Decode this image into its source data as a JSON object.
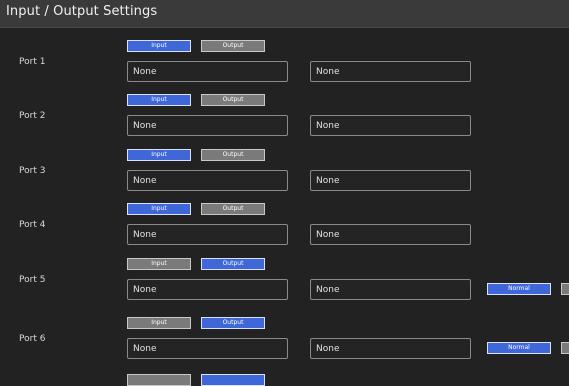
{
  "window": {
    "title": "Input / Output Settings"
  },
  "button_labels": {
    "input": "Input",
    "output": "Output",
    "normal": "Normal"
  },
  "ports": [
    {
      "label": "Port 1",
      "mode": "input",
      "field1": "None",
      "field2": "None"
    },
    {
      "label": "Port 2",
      "mode": "input",
      "field1": "None",
      "field2": "None"
    },
    {
      "label": "Port 3",
      "mode": "input",
      "field1": "None",
      "field2": "None"
    },
    {
      "label": "Port 4",
      "mode": "input",
      "field1": "None",
      "field2": "None"
    },
    {
      "label": "Port 5",
      "mode": "output",
      "field1": "None",
      "field2": "None",
      "output_mode": "Normal"
    },
    {
      "label": "Port 6",
      "mode": "output",
      "field1": "None",
      "field2": "None",
      "output_mode": "Normal"
    }
  ],
  "colors": {
    "background": "#222222",
    "active_button": "#3f67d8",
    "inactive_button": "#7a7a7a",
    "title_bar": "#3a3a3a"
  }
}
